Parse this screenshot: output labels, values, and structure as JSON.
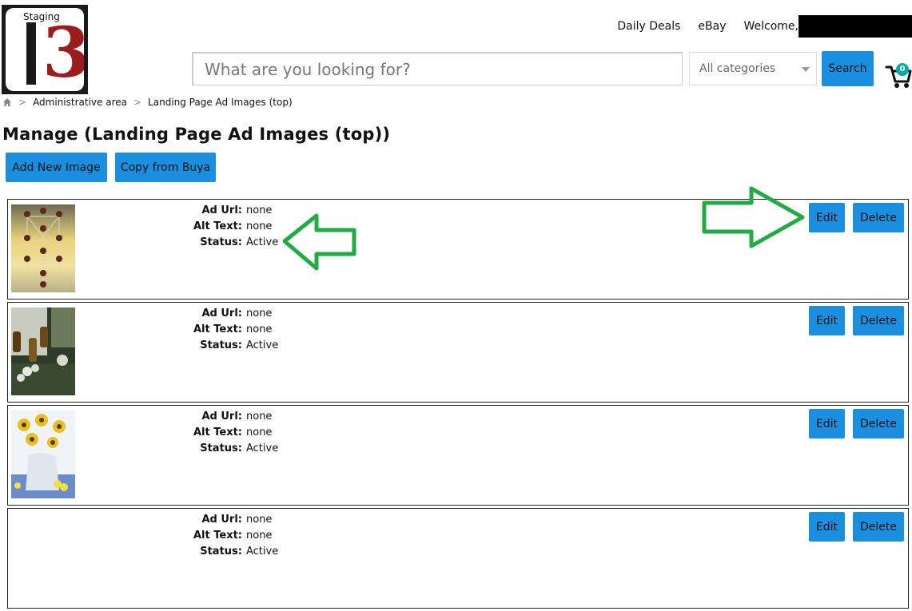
{
  "brand": {
    "staging_label": "Staging"
  },
  "topnav": {
    "daily_deals": "Daily Deals",
    "ebay": "eBay",
    "welcome": "Welcome,"
  },
  "search": {
    "placeholder": "What are you looking for?",
    "category": "All categories",
    "button": "Search"
  },
  "cart": {
    "count": "0"
  },
  "breadcrumb": {
    "home_icon": "home-icon",
    "sep": ">",
    "items": [
      "Administrative area",
      "Landing Page Ad Images (top)"
    ]
  },
  "page": {
    "title": "Manage (Landing Page Ad Images (top))"
  },
  "actions": {
    "add_new": "Add New Image",
    "copy": "Copy from Buya"
  },
  "labels": {
    "ad_url": "Ad Url:",
    "alt_text": "Alt Text:",
    "status": "Status:",
    "edit": "Edit",
    "delete": "Delete"
  },
  "rows": [
    {
      "ad_url": "none",
      "alt_text": "none",
      "status": "Active"
    },
    {
      "ad_url": "none",
      "alt_text": "none",
      "status": "Active"
    },
    {
      "ad_url": "none",
      "alt_text": "none",
      "status": "Active"
    },
    {
      "ad_url": "none",
      "alt_text": "none",
      "status": "Active"
    }
  ],
  "colors": {
    "button": "#1a8fe0",
    "annotation_arrow": "#22aa44",
    "brand_red": "#9b1c1c"
  }
}
